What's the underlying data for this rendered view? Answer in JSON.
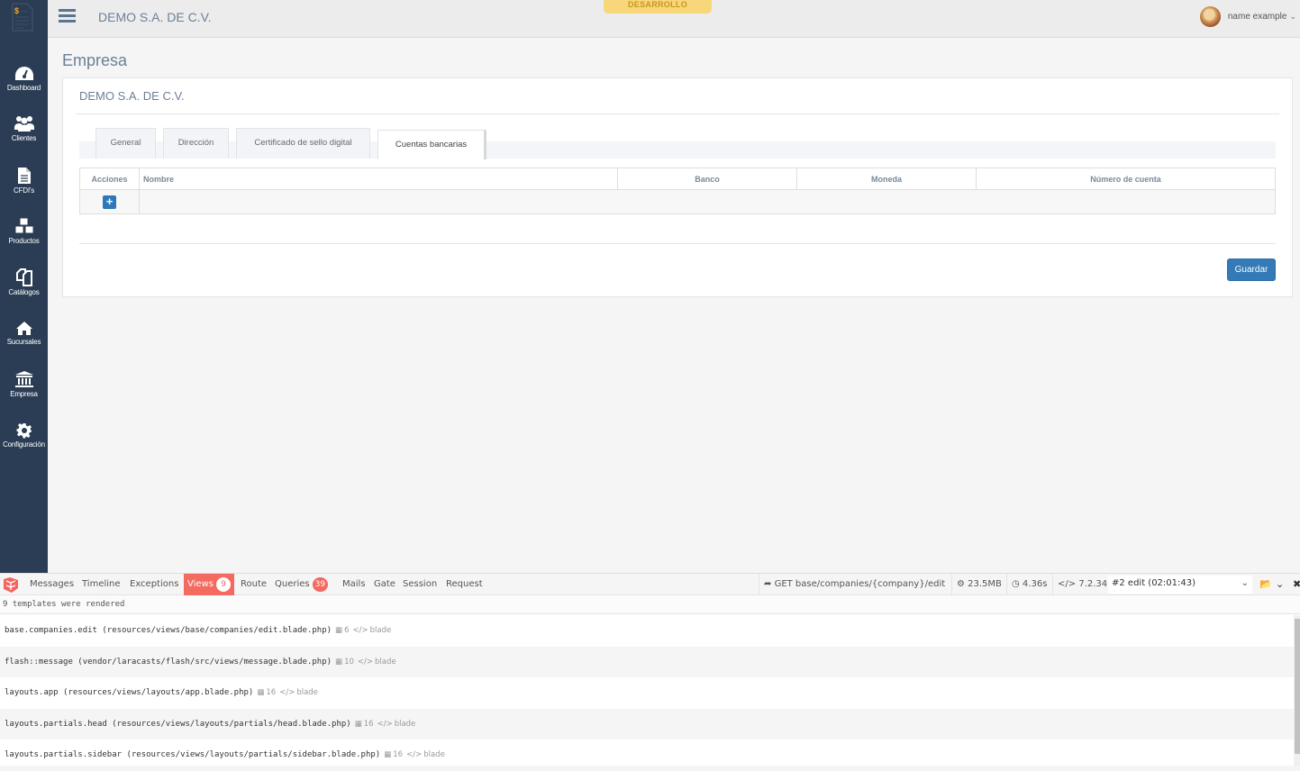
{
  "app": {
    "brand": "DEMO S.A. DE C.V.",
    "environment_badge": "DESARROLLO",
    "user_name": "name example"
  },
  "sidebar": {
    "items": [
      {
        "label": "Dashboard",
        "icon": "dashboard-icon"
      },
      {
        "label": "Clientes",
        "icon": "users-icon"
      },
      {
        "label": "CFDI's",
        "icon": "document-icon"
      },
      {
        "label": "Productos",
        "icon": "cubes-icon"
      },
      {
        "label": "Catálogos",
        "icon": "copy-icon"
      },
      {
        "label": "Sucursales",
        "icon": "home-icon"
      },
      {
        "label": "Empresa",
        "icon": "bank-icon"
      },
      {
        "label": "Configuración",
        "icon": "gear-icon"
      }
    ]
  },
  "page": {
    "title": "Empresa",
    "panel_title": "DEMO S.A. DE C.V.",
    "tabs": [
      {
        "label": "General",
        "active": false
      },
      {
        "label": "Dirección",
        "active": false
      },
      {
        "label": "Certificado de sello digital",
        "active": false
      },
      {
        "label": "Cuentas bancarias",
        "active": true
      }
    ],
    "table": {
      "headers": [
        "Acciones",
        "Nombre",
        "Banco",
        "Moneda",
        "Número de cuenta"
      ],
      "add_label": "+"
    },
    "save_label": "Guardar"
  },
  "debugbar": {
    "tabs": [
      {
        "label": "Messages"
      },
      {
        "label": "Timeline"
      },
      {
        "label": "Exceptions"
      },
      {
        "label": "Views",
        "badge": "9",
        "active": true
      },
      {
        "label": "Route"
      },
      {
        "label": "Queries",
        "badge": "39"
      },
      {
        "label": "Mails"
      },
      {
        "label": "Gate"
      },
      {
        "label": "Session"
      },
      {
        "label": "Request"
      }
    ],
    "route": "GET base/companies/{company}/edit",
    "memory": "23.5MB",
    "time": "4.36s",
    "php_version": "7.2.34",
    "request_select": "#2 edit (02:01:43)",
    "summary": "9 templates were rendered",
    "views": [
      {
        "name": "base.companies.edit (resources/views/base/companies/edit.blade.php)",
        "params": "6",
        "type": "blade"
      },
      {
        "name": "flash::message (vendor/laracasts/flash/src/views/message.blade.php)",
        "params": "10",
        "type": "blade"
      },
      {
        "name": "layouts.app (resources/views/layouts/app.blade.php)",
        "params": "16",
        "type": "blade"
      },
      {
        "name": "layouts.partials.head (resources/views/layouts/partials/head.blade.php)",
        "params": "16",
        "type": "blade"
      },
      {
        "name": "layouts.partials.sidebar (resources/views/layouts/partials/sidebar.blade.php)",
        "params": "16",
        "type": "blade"
      }
    ]
  }
}
